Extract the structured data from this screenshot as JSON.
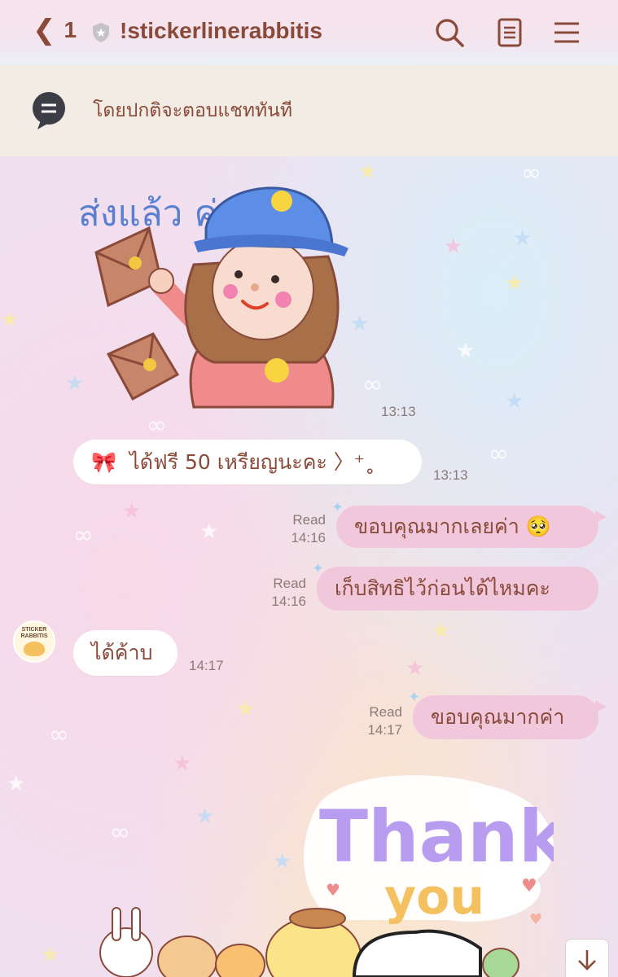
{
  "header": {
    "back_count": "1",
    "chat_title": "!stickerlinerabbitis",
    "icons": [
      "back-chevron-icon",
      "shield-icon",
      "search-icon",
      "notes-icon",
      "menu-icon"
    ]
  },
  "notice": {
    "text": "โดยปกติจะตอบแชททันที"
  },
  "messages": {
    "sticker_send": {
      "time": "13:13",
      "sticker_text": "ส่งแล้ว ค่ะ"
    },
    "coin_message": {
      "emoji": "🎀",
      "text": "ได้ฟรี 50 เหรียญนะคะ 〉⁺˳",
      "time": "13:13"
    },
    "out1": {
      "text": "ขอบคุณมากเลยค่า 🥺",
      "read": "Read",
      "time": "14:16"
    },
    "out2": {
      "text": "เก็บสิทธิไว้ก่อนได้ไหมคะ",
      "read": "Read",
      "time": "14:16"
    },
    "in1": {
      "text": "ได้ค้าบ",
      "time": "14:17",
      "avatar_text": "STICKER RABBITIS"
    },
    "out3": {
      "text": "ขอบคุณมากค่า",
      "read": "Read",
      "time": "14:17"
    },
    "thanks_sticker": {
      "line1": "Thank",
      "line2": "you"
    }
  },
  "colors": {
    "accent_text": "#8a4a3a",
    "outgoing_bubble": "#f1c7dc",
    "incoming_bubble": "#ffffff",
    "notice_bg": "#f3ece4"
  }
}
